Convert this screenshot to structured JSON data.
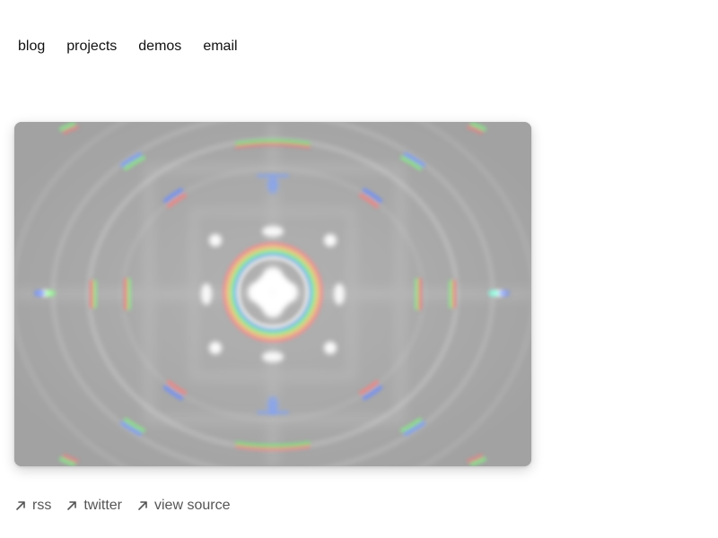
{
  "nav": {
    "items": [
      {
        "label": "blog"
      },
      {
        "label": "projects"
      },
      {
        "label": "demos"
      },
      {
        "label": "email"
      }
    ]
  },
  "hero": {
    "icon": "diffraction-pattern-image",
    "background_color": "#a6a6a6"
  },
  "footer": {
    "links": [
      {
        "label": "rss",
        "icon": "arrow-up-right-icon"
      },
      {
        "label": "twitter",
        "icon": "arrow-up-right-icon"
      },
      {
        "label": "view source",
        "icon": "arrow-up-right-icon"
      }
    ],
    "link_color": "#555555"
  }
}
